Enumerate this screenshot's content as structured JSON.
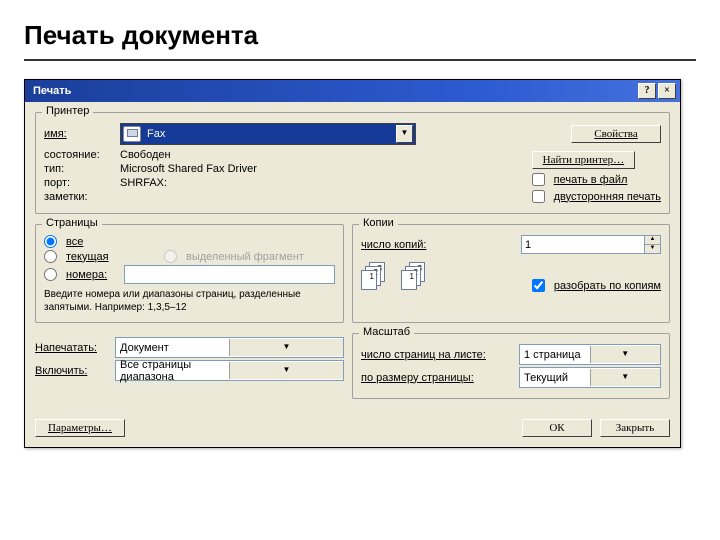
{
  "slide": {
    "title": "Печать документа"
  },
  "dialog": {
    "title": "Печать",
    "help_btn": "?",
    "close_btn": "×",
    "printer": {
      "legend": "Принтер",
      "name_label": "имя:",
      "name_value": "Fax",
      "state_label": "состояние:",
      "state_value": "Свободен",
      "type_label": "тип:",
      "type_value": "Microsoft Shared Fax Driver",
      "port_label": "порт:",
      "port_value": "SHRFAX:",
      "notes_label": "заметки:",
      "properties_btn": "Свойства",
      "find_btn": "Найти принтер…",
      "to_file_label": "печать в файл",
      "to_file_checked": false,
      "duplex_label": "двусторонняя печать",
      "duplex_checked": false
    },
    "pages": {
      "legend": "Страницы",
      "all": {
        "label": "все",
        "selected": true
      },
      "current": {
        "label": "текущая",
        "selected": false
      },
      "selection": {
        "label": "выделенный фрагмент",
        "selected": false,
        "enabled": false
      },
      "numbers": {
        "label": "номера:",
        "selected": false,
        "value": ""
      },
      "hint": "Введите номера или диапазоны страниц, разделенные запятыми. Например: 1,3,5–12"
    },
    "copies": {
      "legend": "Копии",
      "count_label": "число копий:",
      "count_value": "1",
      "collate_label": "разобрать по копиям",
      "collate_checked": true
    },
    "scale": {
      "legend": "Масштаб",
      "per_sheet_label": "число страниц на листе:",
      "per_sheet_value": "1 страница",
      "fit_label": "по размеру страницы:",
      "fit_value": "Текущий"
    },
    "print_what": {
      "label": "Напечатать:",
      "value": "Документ"
    },
    "include": {
      "label": "Включить:",
      "value": "Все страницы диапазона"
    },
    "footer": {
      "options_btn": "Параметры…",
      "ok_btn": "ОК",
      "close_btn": "Закрыть"
    }
  }
}
